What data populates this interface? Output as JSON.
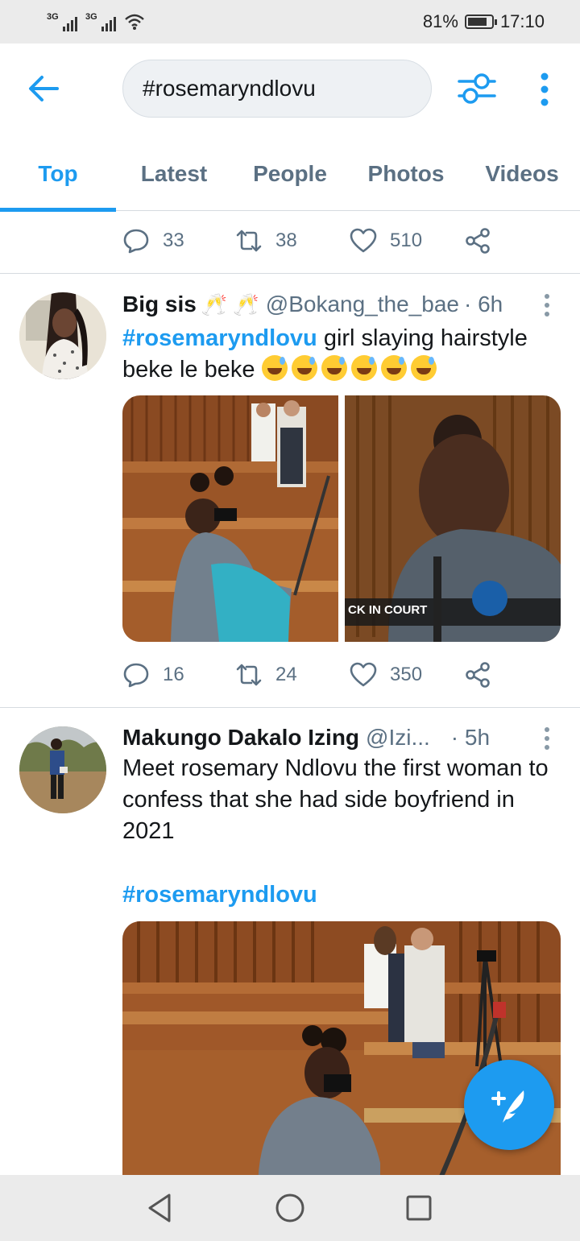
{
  "status_bar": {
    "signal1_label": "3G",
    "signal2_label": "3G",
    "battery_percent": "81%",
    "battery_level": 0.81,
    "time": "17:10"
  },
  "header": {
    "search_value": "#rosemaryndlovu",
    "back_icon": "arrow-left-icon",
    "filter_icon": "sliders-icon",
    "more_icon": "vertical-dots-icon"
  },
  "tabs": [
    {
      "label": "Top",
      "active": true
    },
    {
      "label": "Latest",
      "active": false
    },
    {
      "label": "People",
      "active": false
    },
    {
      "label": "Photos",
      "active": false
    },
    {
      "label": "Videos",
      "active": false
    }
  ],
  "prev_tweet_actions": {
    "replies": "33",
    "retweets": "38",
    "likes": "510"
  },
  "tweets": [
    {
      "name": "Big sis",
      "name_emoji": "🥂 🥂",
      "handle": "@Bokang_the_bae",
      "time": "· 6h",
      "hashtag": "#rosemaryndlovu",
      "text_after_hashtag": " girl slaying hairstyle beke le beke ",
      "emoji_count": 6,
      "media_caption": "CK IN COURT",
      "actions": {
        "replies": "16",
        "retweets": "24",
        "likes": "350"
      }
    },
    {
      "name": "Makungo Dakalo Izing",
      "handle": "@Izi...",
      "time": "· 5h",
      "text": "Meet rosemary Ndlovu the first woman to confess that she had side boyfriend in 2021",
      "hashtag": "#rosemaryndlovu"
    }
  ],
  "colors": {
    "accent": "#1d9bf0",
    "secondary_text": "#5b7083",
    "divider": "#d6dbe0"
  }
}
